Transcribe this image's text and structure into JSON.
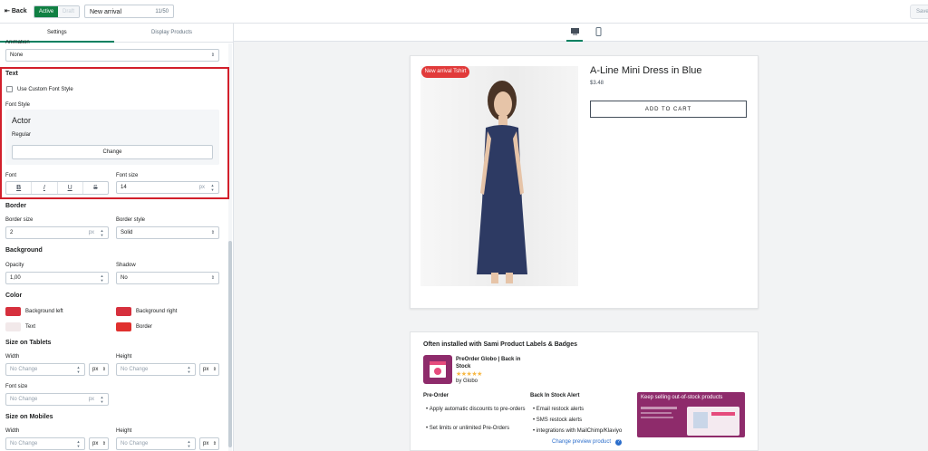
{
  "topbar": {
    "back_label": "Back",
    "status_active": "Active",
    "status_draft": "Draft",
    "label_name": "New arrival",
    "label_count": "11/50",
    "save_label": "Save"
  },
  "sidebar": {
    "tabs": [
      "Settings",
      "Display Products"
    ],
    "animation": {
      "label": "Animation",
      "value": "None"
    },
    "text": {
      "heading": "Text",
      "custom_font_label": "Use Custom Font Style",
      "font_style_label": "Font Style",
      "font_name": "Actor",
      "font_variant": "Regular",
      "change_label": "Change",
      "font_label": "Font",
      "font_size_label": "Font size",
      "font_size_value": "14",
      "unit": "px",
      "fmt": [
        "B",
        "I",
        "U",
        "S"
      ]
    },
    "border": {
      "heading": "Border",
      "size_label": "Border size",
      "size_value": "2",
      "style_label": "Border style",
      "style_value": "Solid"
    },
    "background": {
      "heading": "Background",
      "opacity_label": "Opacity",
      "opacity_value": "1,00",
      "shadow_label": "Shadow",
      "shadow_value": "No"
    },
    "color": {
      "heading": "Color",
      "bg_left": "Background left",
      "bg_right": "Background right",
      "text": "Text",
      "border": "Border",
      "bg_left_color": "#d6303d",
      "bg_right_color": "#d6303d",
      "text_color": "#f2e9ea",
      "border_color": "#e0302e"
    },
    "tablets": {
      "heading": "Size on Tablets",
      "width_label": "Width",
      "height_label": "Height",
      "font_size_label": "Font size",
      "placeholder": "No Change",
      "unit": "px"
    },
    "mobiles": {
      "heading": "Size on Mobiles",
      "width_label": "Width",
      "height_label": "Height",
      "placeholder": "No Change",
      "unit": "px"
    }
  },
  "preview": {
    "badge": "New arrival Tshirt",
    "product_title": "A-Line Mini Dress in Blue",
    "price": "$3.48",
    "add_to_cart": "ADD TO CART",
    "recommend_title": "Often installed with Sami Product Labels & Badges",
    "app_name": "PreOrder Globo | Back in Stock",
    "stars": "★★★★★",
    "by": "by Globo",
    "col1_title": "Pre-Order",
    "col1_items": [
      "Apply automatic discounts to pre-orders",
      "Set limits or unlimited Pre-Orders"
    ],
    "col2_title": "Back In Stock Alert",
    "col2_items": [
      "Email restock alerts",
      "SMS restock alerts",
      "integrations with MailChimp/Klaviyo"
    ],
    "promo_text": "Keep selling out-of-stock products",
    "change_preview": "Change preview product",
    "help": "?"
  }
}
